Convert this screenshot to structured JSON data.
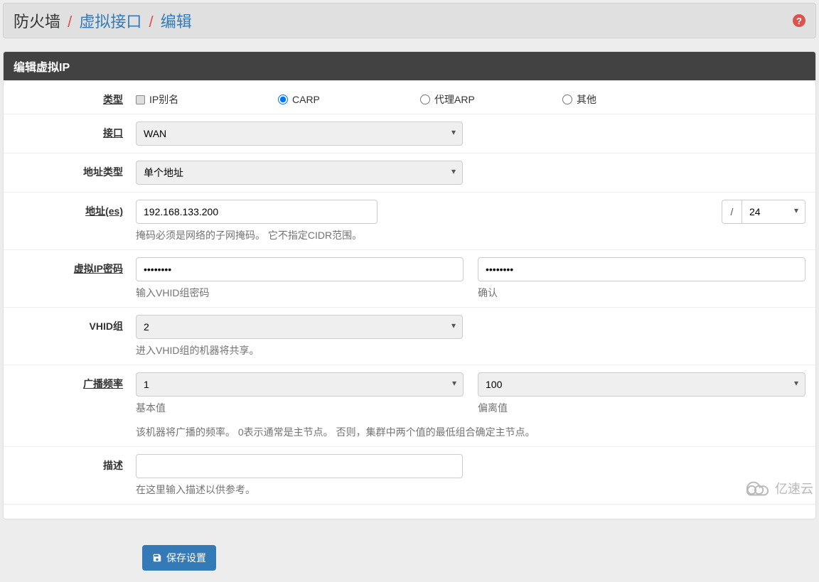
{
  "breadcrumb": {
    "root": "防火墙",
    "link1": "虚拟接口",
    "link2": "编辑"
  },
  "panel": {
    "title": "编辑虚拟IP"
  },
  "labels": {
    "type": "类型",
    "interface": "接口",
    "addr_type": "地址类型",
    "addresses": "地址(es)",
    "vip_password": "虚拟IP密码",
    "vhid_group": "VHID组",
    "adv_freq": "广播频率",
    "description": "描述"
  },
  "type_options": {
    "ipalias": "IP别名",
    "carp": "CARP",
    "proxyarp": "代理ARP",
    "other": "其他",
    "selected": "carp"
  },
  "interface": {
    "value": "WAN"
  },
  "addr_type": {
    "value": "单个地址"
  },
  "address": {
    "value": "192.168.133.200",
    "cidr": "24",
    "help": "掩码必须是网络的子网掩码。 它不指定CIDR范围。"
  },
  "password": {
    "value": "••••••••",
    "confirm": "••••••••",
    "help": "输入VHID组密码",
    "confirm_help": "确认"
  },
  "vhid": {
    "value": "2",
    "help": "进入VHID组的机器将共享。"
  },
  "adv": {
    "base": "1",
    "base_help": "基本值",
    "skew": "100",
    "skew_help": "偏离值",
    "help": "该机器将广播的频率。 0表示通常是主节点。 否则，集群中两个值的最低组合确定主节点。"
  },
  "description": {
    "value": "",
    "help": "在这里输入描述以供参考。"
  },
  "save_label": "保存设置",
  "watermark": "亿速云"
}
